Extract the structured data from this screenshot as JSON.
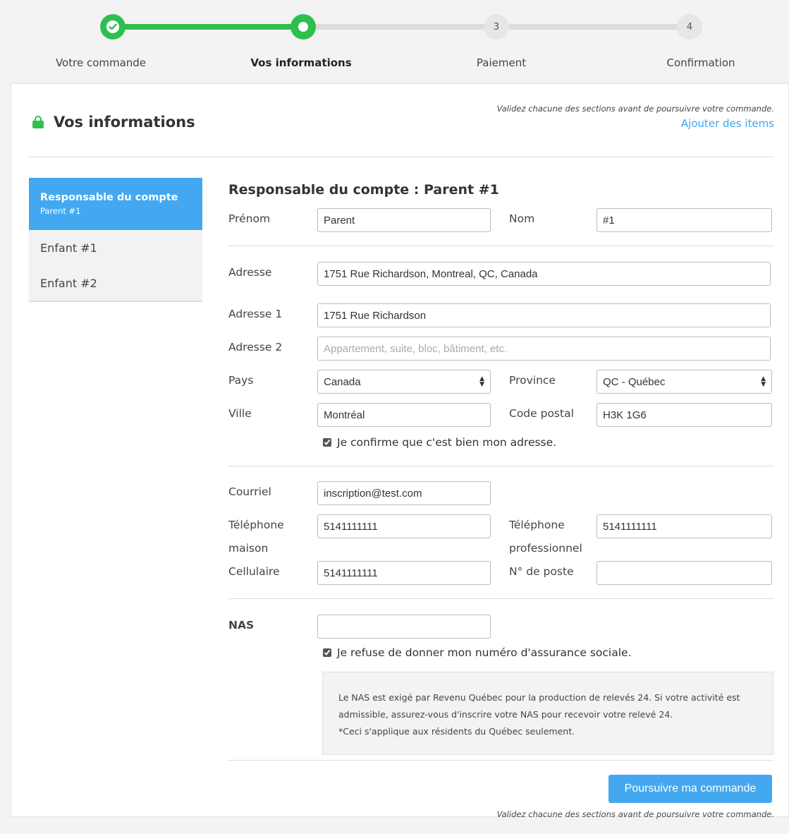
{
  "stepper": {
    "steps": [
      {
        "label": "Votre commande",
        "number": "",
        "state": "done"
      },
      {
        "label": "Vos informations",
        "number": "",
        "state": "active"
      },
      {
        "label": "Paiement",
        "number": "3",
        "state": "future"
      },
      {
        "label": "Confirmation",
        "number": "4",
        "state": "future"
      }
    ]
  },
  "header": {
    "title": "Vos informations",
    "validate_note": "Validez chacune des sections avant de poursuivre votre commande.",
    "add_items_link": "Ajouter des items"
  },
  "sidebar": {
    "items": [
      {
        "title": "Responsable du compte",
        "subtitle": "Parent #1"
      },
      {
        "title": "Enfant #1"
      },
      {
        "title": "Enfant #2"
      }
    ]
  },
  "form": {
    "title": "Responsable du compte : Parent #1",
    "first_name": {
      "label": "Prénom",
      "value": "Parent"
    },
    "last_name": {
      "label": "Nom",
      "value": "#1"
    },
    "address": {
      "label": "Adresse",
      "value": "1751 Rue Richardson, Montreal, QC, Canada"
    },
    "address1": {
      "label": "Adresse 1",
      "value": "1751 Rue Richardson"
    },
    "address2": {
      "label": "Adresse 2",
      "value": "",
      "placeholder": "Appartement, suite, bloc, bâtiment, etc."
    },
    "country": {
      "label": "Pays",
      "value": "Canada"
    },
    "province": {
      "label": "Province",
      "value": "QC - Québec"
    },
    "city": {
      "label": "Ville",
      "value": "Montréal"
    },
    "postal_code": {
      "label": "Code postal",
      "value": "H3K 1G6"
    },
    "confirm_address": {
      "label": "Je confirme que c'est bien mon adresse.",
      "checked": true
    },
    "email": {
      "label": "Courriel",
      "value": "inscription@test.com"
    },
    "home_phone": {
      "label_line1": "Téléphone",
      "label_line2": "maison",
      "value": "5141111111"
    },
    "work_phone": {
      "label_line1": "Téléphone",
      "label_line2": "professionnel",
      "value": "5141111111"
    },
    "cell_phone": {
      "label": "Cellulaire",
      "value": "5141111111"
    },
    "extension": {
      "label": "N° de poste",
      "value": ""
    },
    "nas": {
      "label": "NAS",
      "value": ""
    },
    "refuse_nas": {
      "label": "Je refuse de donner mon numéro d'assurance sociale.",
      "checked": true
    },
    "nas_info": {
      "line1": "Le NAS est exigé par Revenu Québec pour la production de relevés 24. Si votre activité est",
      "line2": "admissible, assurez-vous d'inscrire votre NAS pour recevoir votre relevé 24.",
      "line3": "*Ceci s'applique aux résidents du Québec seulement."
    },
    "continue_button": "Poursuivre ma commande",
    "validate_note_bottom": "Validez chacune des sections avant de poursuivre votre commande."
  },
  "colors": {
    "accent_blue": "#43a8f0",
    "success_green": "#2fbf50"
  }
}
